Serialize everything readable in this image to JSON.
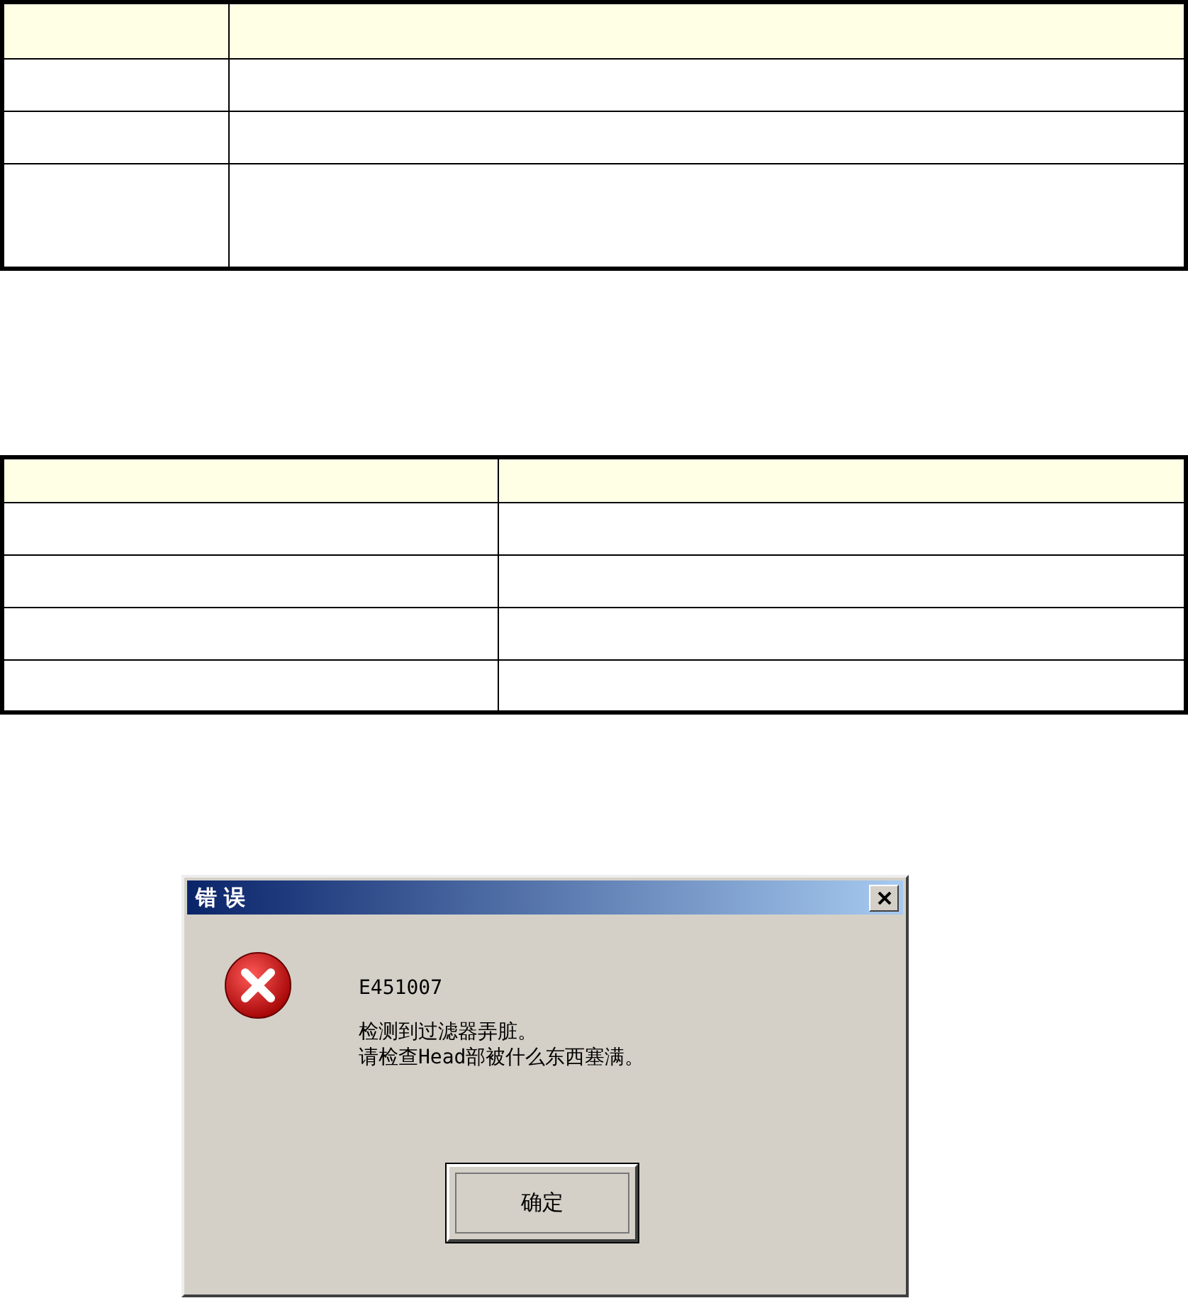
{
  "tables": [
    {
      "kind": "narrow-first",
      "rows": [
        {
          "kind": "header"
        },
        {
          "kind": "row"
        },
        {
          "kind": "row"
        },
        {
          "kind": "tall"
        }
      ]
    },
    {
      "kind": "even",
      "rows": [
        {
          "kind": "header"
        },
        {
          "kind": "row"
        },
        {
          "kind": "row"
        },
        {
          "kind": "row"
        },
        {
          "kind": "row"
        }
      ]
    }
  ],
  "dialog": {
    "title": "错 误",
    "code": "E451007",
    "message_lines": [
      "检测到过滤器弄脏。",
      "请检查Head部被什么东西塞满。"
    ],
    "buttons": [
      {
        "label": "确定",
        "selected": true
      }
    ]
  }
}
